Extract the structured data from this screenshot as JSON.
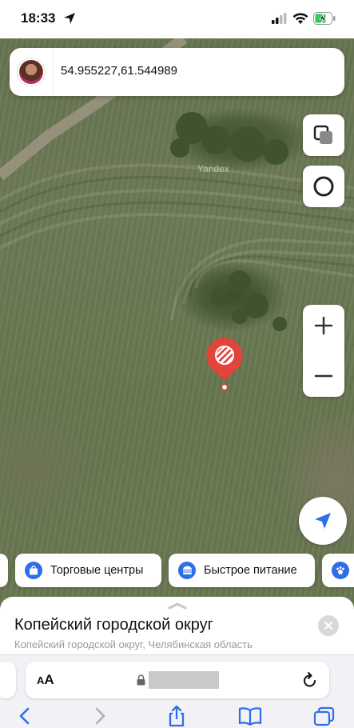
{
  "status_bar": {
    "time": "18:33",
    "icons": [
      "location-arrow-icon",
      "cellular-signal-icon",
      "wifi-icon",
      "battery-charging-icon"
    ]
  },
  "search": {
    "coordinates": "54.955227,61.544989",
    "avatar": "user-avatar"
  },
  "map": {
    "watermark": "Yandex",
    "controls": [
      "layers-icon",
      "assistant-ring-icon",
      "zoom-in-icon",
      "zoom-out-icon",
      "my-location-icon"
    ],
    "pin": "selected-point-pin"
  },
  "categories": [
    {
      "label": "Торговые центры",
      "icon": "shopping-bag-icon"
    },
    {
      "label": "Быстрое питание",
      "icon": "burger-icon"
    },
    {
      "label": "",
      "icon": "pets-icon"
    }
  ],
  "place_card": {
    "title": "Копейский городской округ",
    "subtitle": "Копейский городской округ, Челябинская область"
  },
  "browser": {
    "text_size_label": "AA",
    "toolbar": [
      "back-icon",
      "forward-icon",
      "share-icon",
      "bookmarks-icon",
      "tabs-icon"
    ]
  },
  "colors": {
    "pin": "#e0443a",
    "accent_blue": "#2f6ee8",
    "sheet_bg": "#ffffff"
  }
}
